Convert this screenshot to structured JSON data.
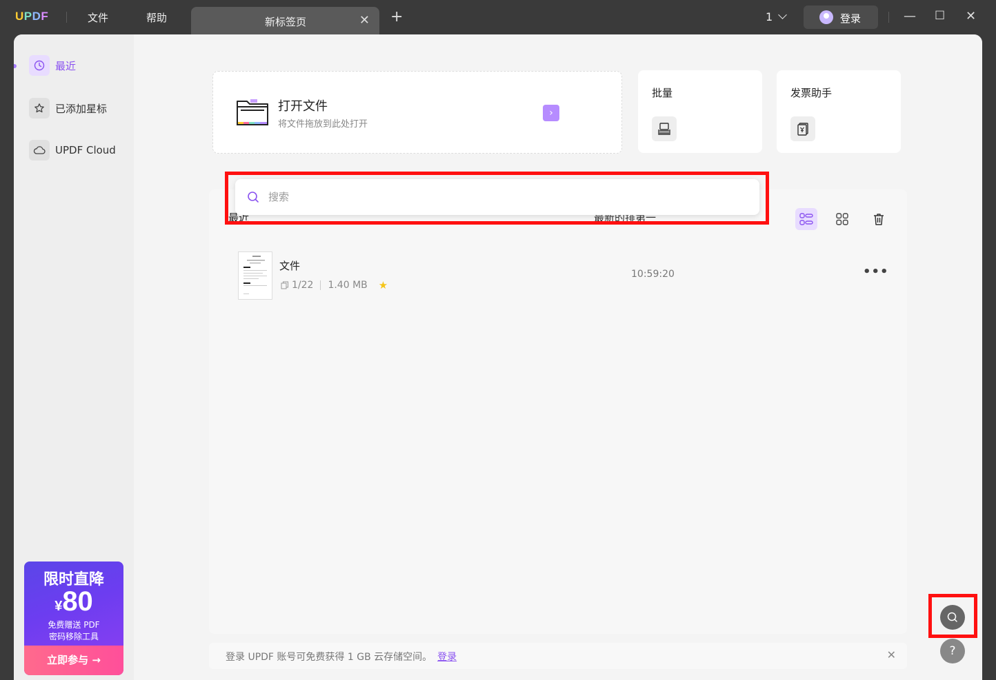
{
  "titlebar": {
    "logo": {
      "u": "U",
      "p": "P",
      "d": "D",
      "f": "F"
    },
    "menus": [
      "文件",
      "帮助"
    ],
    "tab_title": "新标签页",
    "tab_close": "✕",
    "tab_add": "+",
    "tab_count": "1",
    "login_label": "登录",
    "controls": {
      "minimize": "—",
      "maximize": "☐",
      "close": "✕"
    }
  },
  "sidebar": {
    "items": [
      {
        "label": "最近",
        "icon": "clock-icon"
      },
      {
        "label": "已添加星标",
        "icon": "star-icon"
      },
      {
        "label": "UPDF Cloud",
        "icon": "cloud-icon"
      }
    ],
    "promo": {
      "headline": "限时直降",
      "currency": "¥",
      "amount": "80",
      "line1": "免费赠送 PDF",
      "line2": "密码移除工具",
      "cta": "立即参与 →"
    }
  },
  "open_card": {
    "title": "打开文件",
    "subtitle": "将文件拖放到此处打开",
    "arrow": "›"
  },
  "tools": [
    {
      "title": "批量",
      "icon": "batch-stack-icon"
    },
    {
      "title": "发票助手",
      "icon": "invoice-icon"
    }
  ],
  "recent": {
    "label": "最近",
    "sort_label": "最新的排第一",
    "files": [
      {
        "name": "文件",
        "pages": "1/22",
        "size": "1.40 MB",
        "starred": true,
        "time": "10:59:20",
        "more": "•••"
      }
    ]
  },
  "search": {
    "placeholder": "搜索",
    "value": ""
  },
  "notice": {
    "text": "登录 UPDF 账号可免费获得 1 GB 云存储空间。",
    "link": "登录",
    "close": "✕"
  },
  "floating": {
    "help": "?"
  },
  "colors": {
    "accent": "#8a52f0",
    "highlight": "#ff1010",
    "star": "#f5c518"
  }
}
